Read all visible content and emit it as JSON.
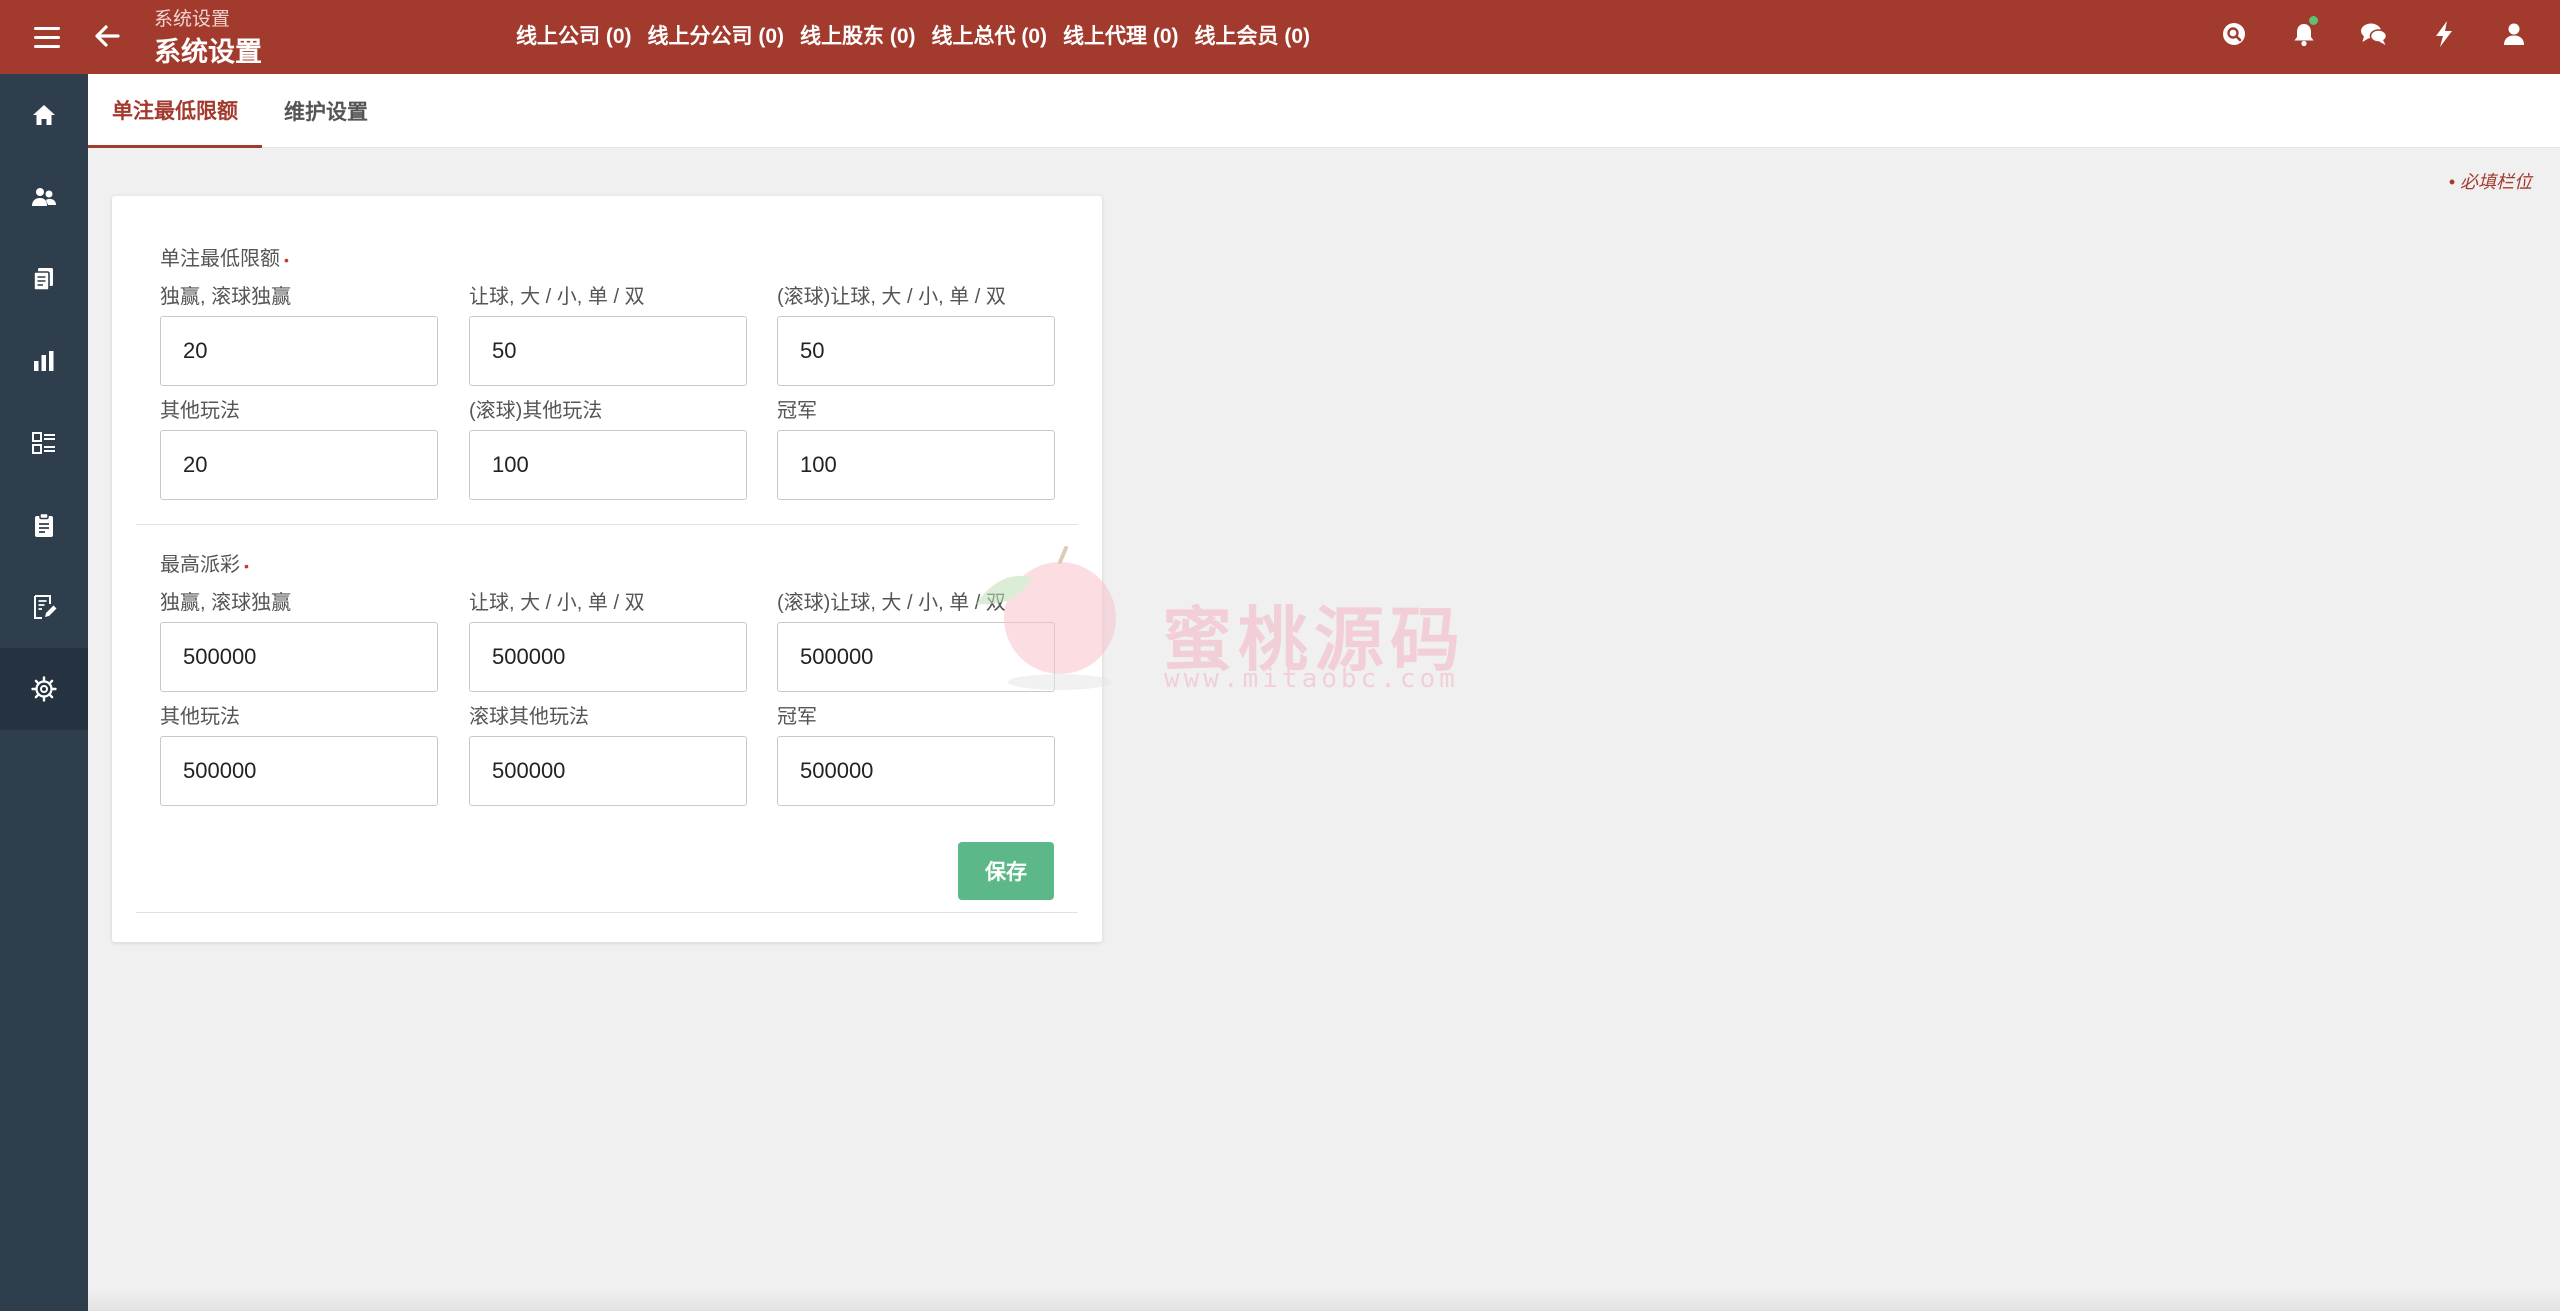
{
  "header": {
    "breadcrumb": "系统设置",
    "title": "系统设置",
    "counters": [
      {
        "label": "线上公司 (0)"
      },
      {
        "label": "线上分公司 (0)"
      },
      {
        "label": "线上股东 (0)"
      },
      {
        "label": "线上总代 (0)"
      },
      {
        "label": "线上代理 (0)"
      },
      {
        "label": "线上会员 (0)"
      }
    ],
    "tools": [
      "search-icon",
      "bell-icon",
      "chat-icon",
      "lightning-icon",
      "user-icon"
    ]
  },
  "sidebar": {
    "items": [
      "home-icon",
      "users-icon",
      "documents-icon",
      "chart-icon",
      "list-icon",
      "clipboard-icon",
      "edit-note-icon",
      "settings-icon"
    ],
    "active": "settings-icon"
  },
  "tabs": [
    {
      "label": "单注最低限额",
      "active": true
    },
    {
      "label": "维护设置",
      "active": false
    }
  ],
  "required_note": "• 必填栏位",
  "sections": [
    {
      "title": "单注最低限额",
      "fields": [
        {
          "label": "独赢, 滚球独赢",
          "value": "20"
        },
        {
          "label": "让球, 大 / 小, 单 / 双",
          "value": "50"
        },
        {
          "label": "(滚球)让球, 大 / 小, 单 / 双",
          "value": "50"
        },
        {
          "label": "其他玩法",
          "value": "20"
        },
        {
          "label": "(滚球)其他玩法",
          "value": "100"
        },
        {
          "label": "冠军",
          "value": "100"
        }
      ]
    },
    {
      "title": "最高派彩",
      "fields": [
        {
          "label": "独赢, 滚球独赢",
          "value": "500000"
        },
        {
          "label": "让球, 大 / 小, 单 / 双",
          "value": "500000"
        },
        {
          "label": "(滚球)让球, 大 / 小, 单 / 双",
          "value": "500000"
        },
        {
          "label": "其他玩法",
          "value": "500000"
        },
        {
          "label": "滚球其他玩法",
          "value": "500000"
        },
        {
          "label": "冠军",
          "value": "500000"
        }
      ]
    }
  ],
  "save_label": "保存",
  "watermark": {
    "text": "蜜桃源码",
    "url": "www.mitaobc.com"
  },
  "colors": {
    "brand": "#a33a2e",
    "sidebar": "#2f3e4c",
    "save": "#5db889"
  }
}
